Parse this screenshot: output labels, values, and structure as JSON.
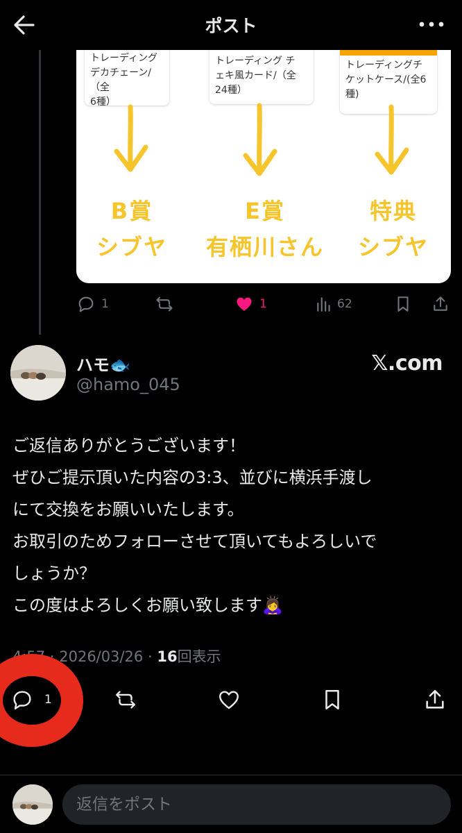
{
  "header": {
    "title": "ポスト",
    "back_icon": "back-arrow-icon",
    "more_icon": "more-dots-icon"
  },
  "quoted_image": {
    "products": [
      {
        "text": "トレーディング\nデカチェーン/（全\n6種）"
      },
      {
        "text": "トレーディング チ\nェキ風カード/（全\n24種）"
      },
      {
        "text": "トレーディングチ\nケットケース/(全6\n種)"
      }
    ],
    "prizes": [
      {
        "line1": "B賞",
        "line2": "シブヤ"
      },
      {
        "line1": "E賞",
        "line2": "有栖川さん"
      },
      {
        "line1": "特典",
        "line2": "シブヤ"
      }
    ],
    "accent_color": "#f6c42b"
  },
  "parent_actions": {
    "reply_count": "1",
    "like_count": "1",
    "views_count": "62",
    "like_color": "#f91880"
  },
  "tweet": {
    "name": "ハモ🐟",
    "handle": "@hamo_045",
    "watermark": "𝕏.com",
    "lines": [
      "ご返信ありがとうございます！",
      "ぜひご提示頂いた内容の3:3、並びに横浜手渡し",
      "にて交換をお願いいたします。",
      "お取引のためフォローさせて頂いてもよろしいで",
      "しょうか？",
      "この度はよろしくお願い致します🙇‍♀️"
    ],
    "meta_time": "4:57",
    "meta_date": "2026/03/26",
    "meta_sep": "·",
    "views_count": "16",
    "views_label": "回表示",
    "reply_count": "1"
  },
  "reply_bar": {
    "placeholder": "返信をポスト"
  },
  "annotation": {
    "color": "#e62a1c"
  }
}
